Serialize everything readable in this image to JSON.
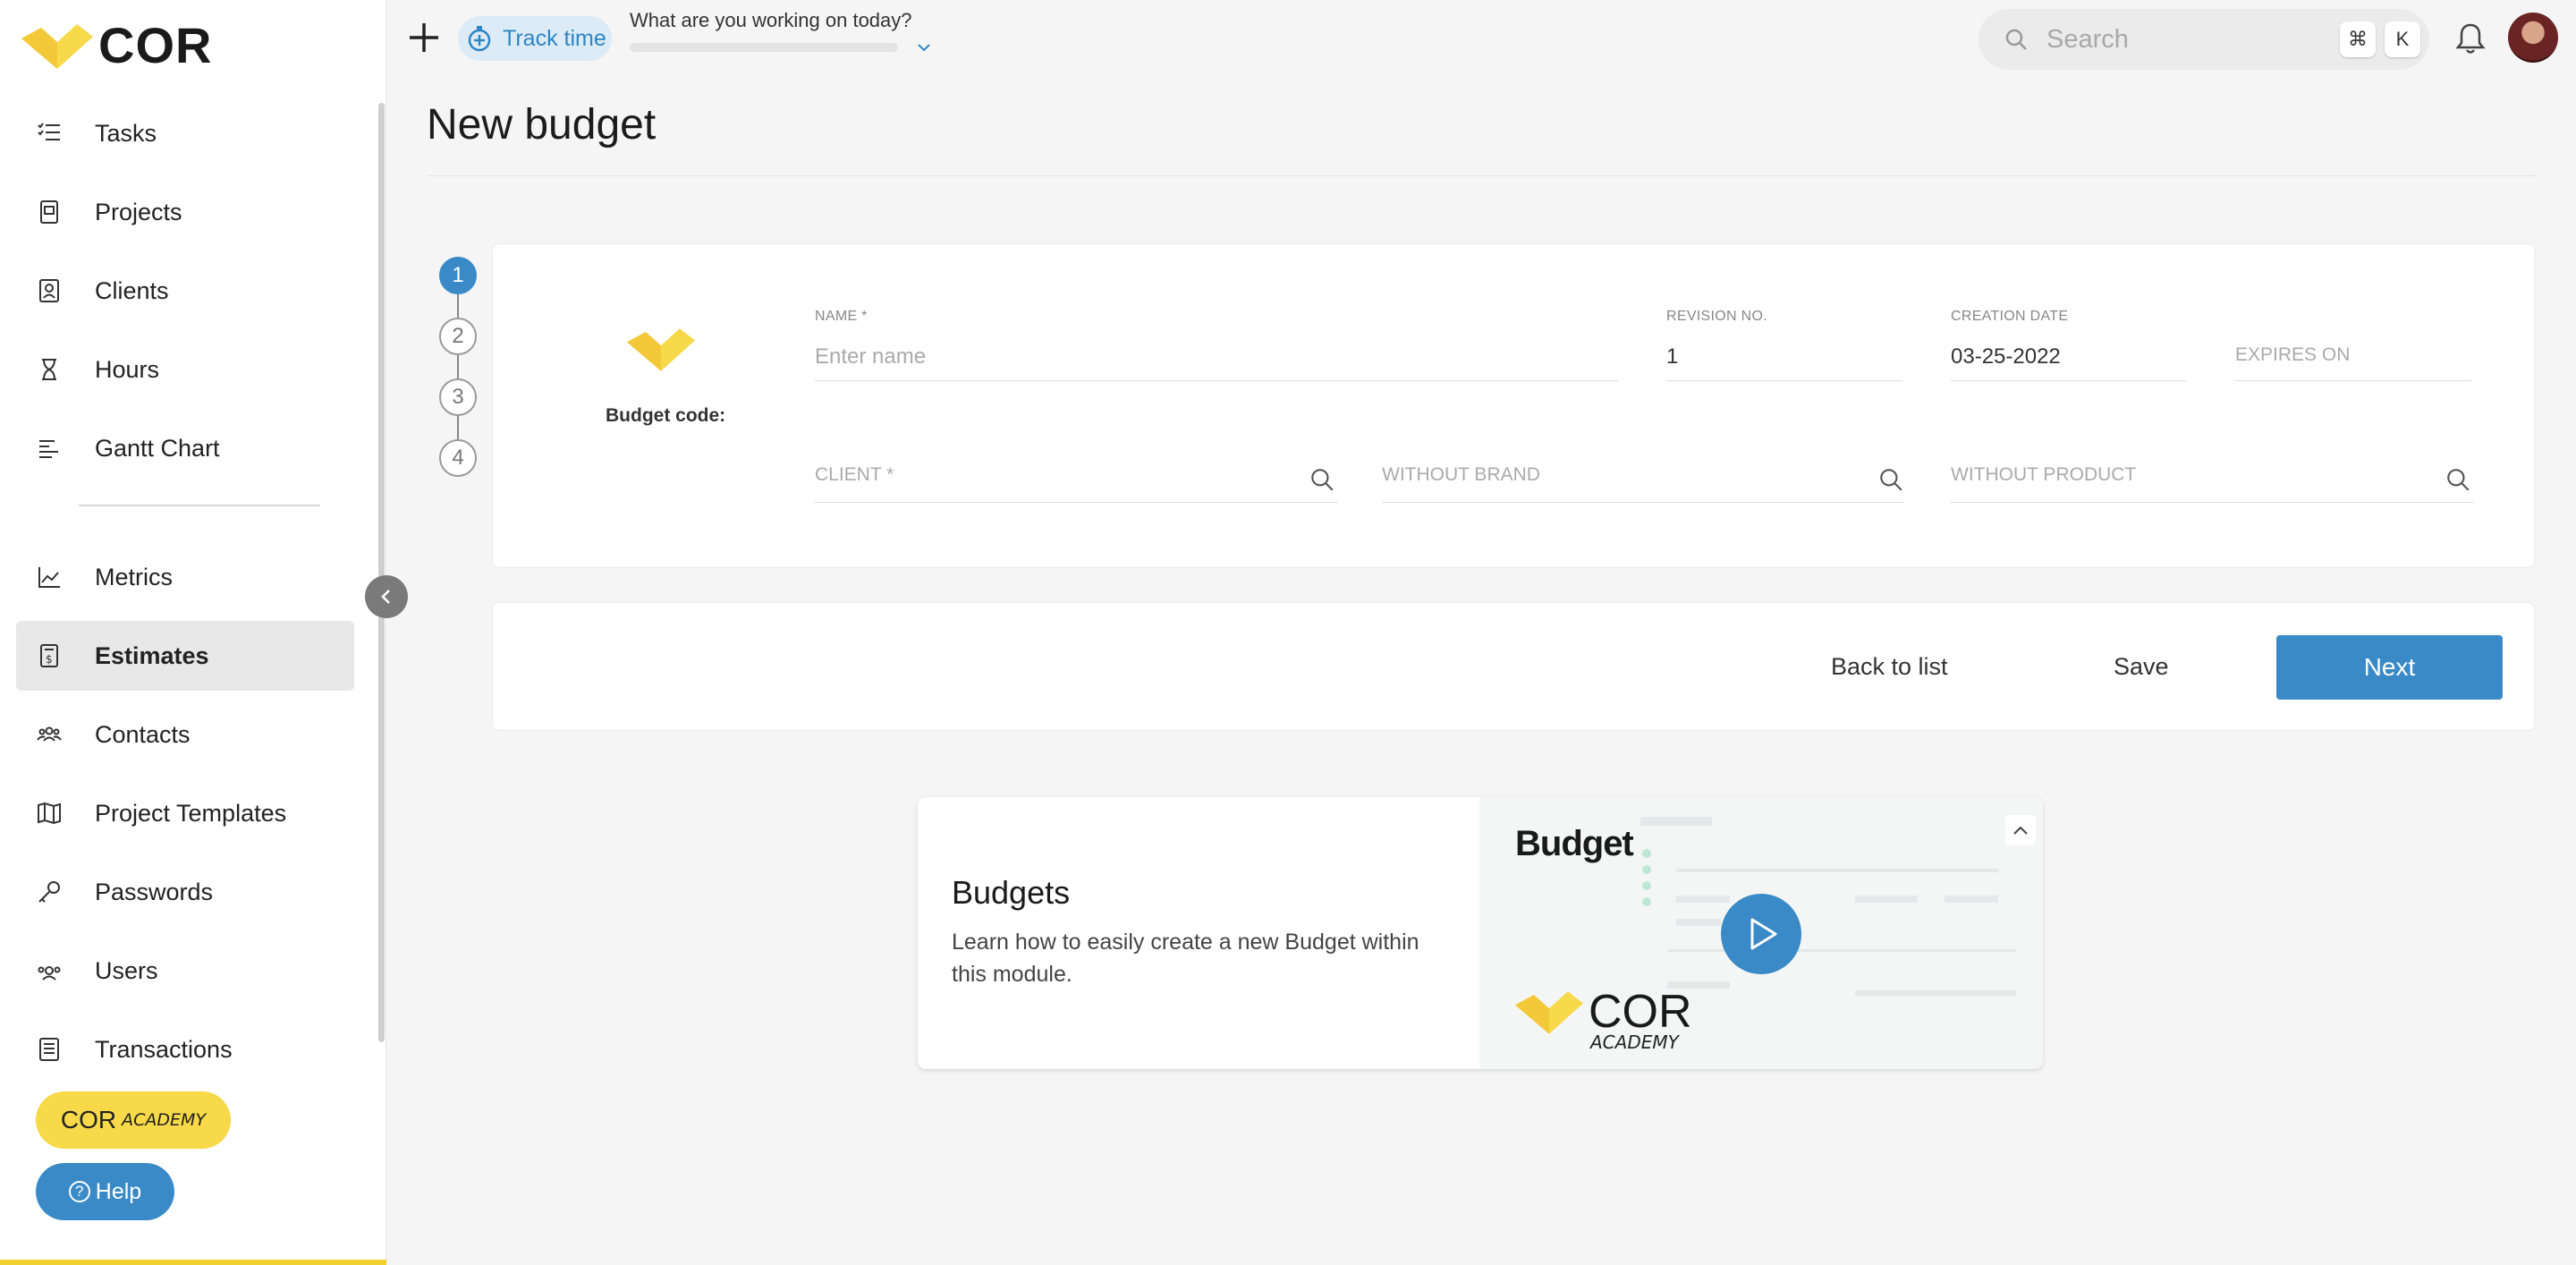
{
  "app": {
    "brand": "COR"
  },
  "sidebar": {
    "items": [
      {
        "label": "Tasks",
        "icon": "tasks-icon"
      },
      {
        "label": "Projects",
        "icon": "projects-icon"
      },
      {
        "label": "Clients",
        "icon": "clients-icon"
      },
      {
        "label": "Hours",
        "icon": "hourglass-icon"
      },
      {
        "label": "Gantt Chart",
        "icon": "gantt-icon"
      },
      {
        "label": "Metrics",
        "icon": "metrics-icon"
      },
      {
        "label": "Estimates",
        "icon": "estimates-icon",
        "active": true
      },
      {
        "label": "Contacts",
        "icon": "contacts-icon"
      },
      {
        "label": "Project Templates",
        "icon": "map-icon"
      },
      {
        "label": "Passwords",
        "icon": "key-icon"
      },
      {
        "label": "Users",
        "icon": "users-icon"
      },
      {
        "label": "Transactions",
        "icon": "transactions-icon"
      }
    ],
    "academy_brand": "COR",
    "academy_word": "ACADEMY",
    "help_label": "Help"
  },
  "topbar": {
    "track_time_label": "Track time",
    "working_question": "What are you working on today?",
    "search_placeholder": "Search",
    "shortcut_cmd": "⌘",
    "shortcut_key": "K"
  },
  "page": {
    "title": "New budget"
  },
  "stepper": {
    "steps": [
      "1",
      "2",
      "3",
      "4"
    ],
    "active": 1
  },
  "form": {
    "budget_code_label": "Budget code:",
    "name_label": "NAME *",
    "name_placeholder": "Enter name",
    "revision_label": "REVISION NO.",
    "revision_value": "1",
    "creation_label": "CREATION DATE",
    "creation_value": "03-25-2022",
    "expires_placeholder": "EXPIRES ON",
    "client_placeholder": "CLIENT *",
    "brand_placeholder": "WITHOUT BRAND",
    "product_placeholder": "WITHOUT PRODUCT"
  },
  "actions": {
    "back_label": "Back to list",
    "save_label": "Save",
    "next_label": "Next"
  },
  "video_card": {
    "title": "Budgets",
    "description": "Learn how to easily create a new Budget within this module.",
    "thumb_title": "Budget",
    "thumb_brand": "COR",
    "thumb_academy": "ACADEMY"
  },
  "colors": {
    "primary": "#3a8ac7",
    "brand_yellow": "#f8d94a"
  }
}
